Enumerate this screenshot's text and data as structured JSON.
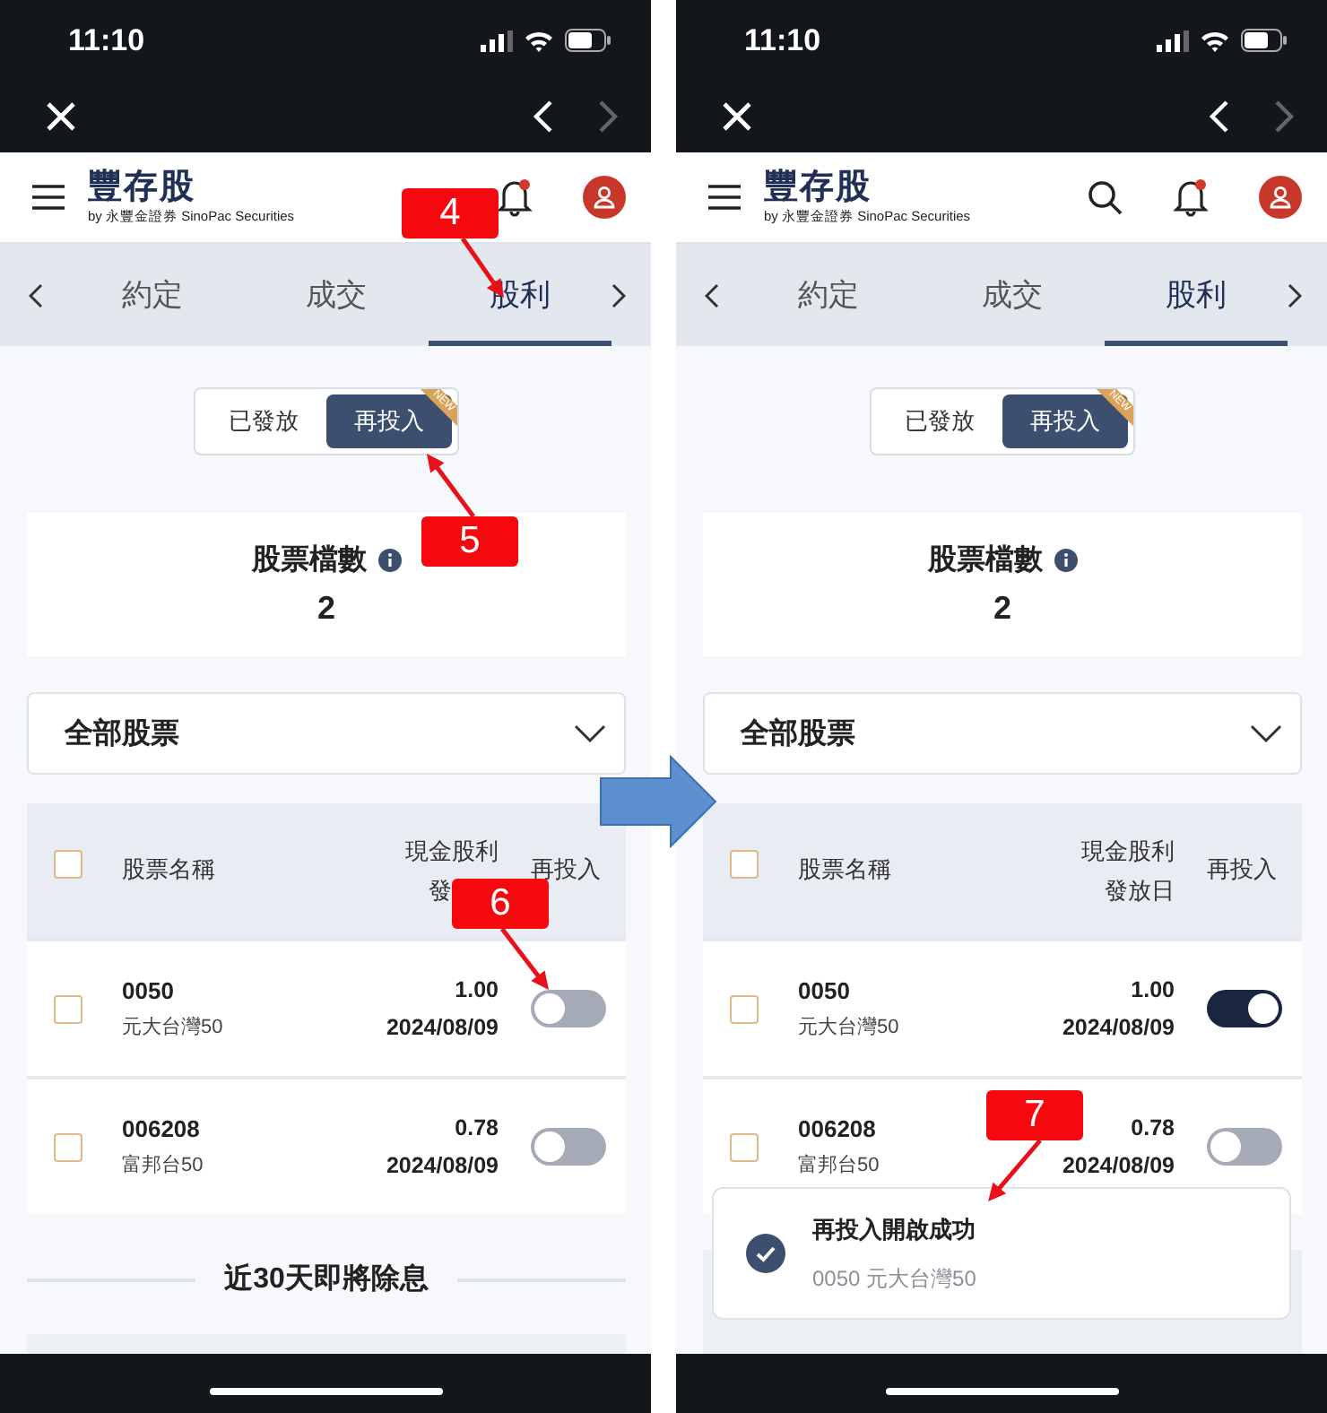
{
  "phones": [
    {
      "status": {
        "time": "11:10"
      },
      "header": {
        "logo": "豐存股",
        "byline": "by 永豐金證券 SinoPac Securities",
        "search": false
      },
      "tabs": [
        {
          "label": "約定",
          "selected": false
        },
        {
          "label": "成交",
          "selected": false
        },
        {
          "label": "股利",
          "selected": true
        }
      ],
      "segment": [
        {
          "label": "已發放",
          "selected": false
        },
        {
          "label": "再投入",
          "selected": true,
          "ribbon": "NEW"
        }
      ],
      "summary": {
        "label": "股票檔數",
        "value": "2"
      },
      "filter": {
        "value": "全部股票"
      },
      "table": {
        "all_checked": false,
        "columns": [
          {
            "lines": [
              "股票名稱"
            ]
          },
          {
            "lines": [
              "現金股利",
              "發"
            ]
          },
          {
            "lines": [
              "再投入"
            ]
          }
        ],
        "rows": [
          {
            "code": "0050",
            "name": "元大台灣50",
            "amount": "1.00",
            "date": "2024/08/09",
            "checked": false,
            "on": false
          },
          {
            "code": "006208",
            "name": "富邦台50",
            "amount": "0.78",
            "date": "2024/08/09",
            "checked": false,
            "on": false
          }
        ]
      },
      "section_title": "近30天即將除息",
      "callouts": [
        {
          "kind": "tab",
          "number": "4"
        },
        {
          "kind": "segment",
          "number": "5"
        },
        {
          "kind": "toggle",
          "number": "6"
        }
      ]
    },
    {
      "status": {
        "time": "11:10"
      },
      "header": {
        "logo": "豐存股",
        "byline": "by 永豐金證券 SinoPac Securities",
        "search": true
      },
      "tabs": [
        {
          "label": "約定",
          "selected": false
        },
        {
          "label": "成交",
          "selected": false
        },
        {
          "label": "股利",
          "selected": true
        }
      ],
      "segment": [
        {
          "label": "已發放",
          "selected": false
        },
        {
          "label": "再投入",
          "selected": true,
          "ribbon": "NEW"
        }
      ],
      "summary": {
        "label": "股票檔數",
        "value": "2"
      },
      "filter": {
        "value": "全部股票"
      },
      "table": {
        "all_checked": false,
        "columns": [
          {
            "lines": [
              "股票名稱"
            ]
          },
          {
            "lines": [
              "現金股利",
              "發放日"
            ]
          },
          {
            "lines": [
              "再投入"
            ]
          }
        ],
        "rows": [
          {
            "code": "0050",
            "name": "元大台灣50",
            "amount": "1.00",
            "date": "2024/08/09",
            "checked": false,
            "on": true
          },
          {
            "code": "006208",
            "name": "富邦台50",
            "amount": "0.78",
            "date": "2024/08/09",
            "checked": false,
            "on": false
          }
        ]
      },
      "toast": {
        "title": "再投入開啟成功",
        "subtitle": "0050 元大台灣50"
      },
      "callouts": [
        {
          "kind": "toast",
          "number": "7"
        }
      ]
    }
  ]
}
